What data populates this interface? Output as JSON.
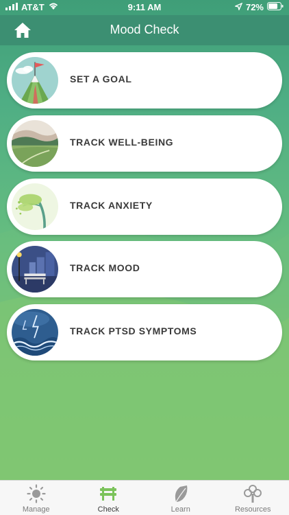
{
  "status_bar": {
    "carrier": "AT&T",
    "time": "9:11 AM",
    "battery": "72%"
  },
  "header": {
    "title": "Mood Check",
    "home_icon": "home-icon"
  },
  "menu": {
    "items": [
      {
        "label": "SET A GOAL",
        "icon": "mountain-flag-icon"
      },
      {
        "label": "TRACK WELL-BEING",
        "icon": "landscape-icon"
      },
      {
        "label": "TRACK ANXIETY",
        "icon": "windy-tree-icon"
      },
      {
        "label": "TRACK MOOD",
        "icon": "park-bench-icon"
      },
      {
        "label": "TRACK PTSD SYMPTOMS",
        "icon": "storm-wave-icon"
      }
    ]
  },
  "tabs": [
    {
      "label": "Manage",
      "icon": "sun-icon",
      "active": false
    },
    {
      "label": "Check",
      "icon": "bench-icon",
      "active": true
    },
    {
      "label": "Learn",
      "icon": "leaf-icon",
      "active": false
    },
    {
      "label": "Resources",
      "icon": "tree-icon",
      "active": false
    }
  ],
  "colors": {
    "header": "#3c8f72",
    "active_tab": "#7cc35b",
    "inactive_tab": "#9a9a9a"
  }
}
